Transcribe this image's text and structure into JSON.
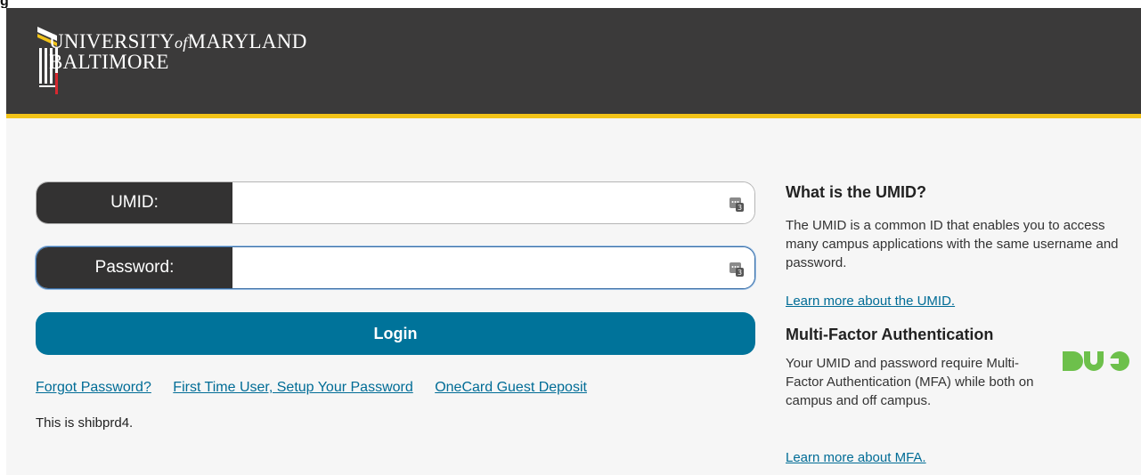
{
  "page_title_fragment": "g",
  "header": {
    "logo_line1_main": "UNIVERSITY",
    "logo_line1_of": "of",
    "logo_line1_end": "MARYLAND",
    "logo_line2": "BALTIMORE"
  },
  "form": {
    "umid_label": "UMID:",
    "umid_value": "",
    "password_label": "Password:",
    "password_value": "",
    "login_label": "Login"
  },
  "links": {
    "forgot_password": "Forgot Password?",
    "first_time_user": "First Time User, Setup Your Password",
    "onecard_deposit": "OneCard Guest Deposit"
  },
  "server_note": "This is shibprd4.",
  "sidebar": {
    "umid_title": "What is the UMID?",
    "umid_description": "The UMID is a common ID that enables you to access many campus applications with the same username and password.",
    "umid_link": "Learn more about the UMID.",
    "mfa_title": "Multi-Factor Authentication",
    "mfa_description": "Your UMID and password require Multi-Factor Authentication (MFA) while both on campus and off campus.",
    "mfa_link": "Learn more about MFA."
  },
  "icons": {
    "logo": "university-logo-icon",
    "field_key": "password-manager-key-icon",
    "duo": "duo-logo-icon"
  },
  "colors": {
    "header_bg": "#3b3a3a",
    "header_stripe": "#f2c318",
    "login_button": "#00739a",
    "link": "#006c96",
    "label_bg": "#333232",
    "duo_green": "#6dc04b"
  }
}
